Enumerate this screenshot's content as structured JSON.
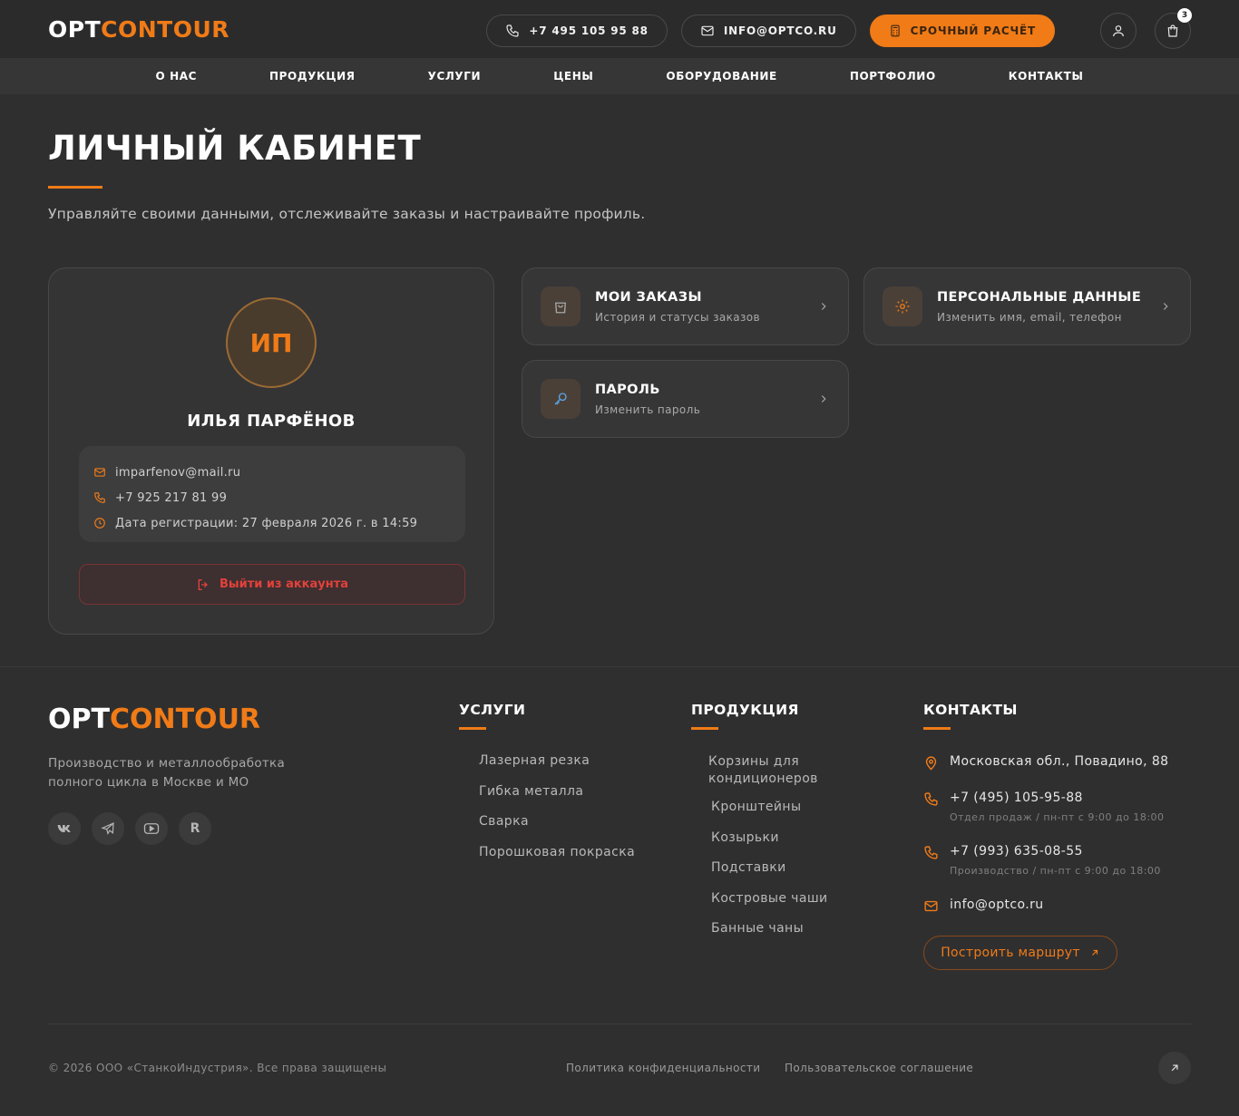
{
  "header": {
    "logo_part1": "OPT",
    "logo_part2": "CONTOUR",
    "phone": "+7 495 105 95 88",
    "email": "INFO@OPTCO.RU",
    "urgent_calc": "СРОЧНЫЙ РАСЧЁТ",
    "cart_count": "3",
    "nav": [
      "О НАС",
      "ПРОДУКЦИЯ",
      "УСЛУГИ",
      "ЦЕНЫ",
      "ОБОРУДОВАНИЕ",
      "ПОРТФОЛИО",
      "КОНТАКТЫ"
    ]
  },
  "page": {
    "title": "ЛИЧНЫЙ КАБИНЕТ",
    "subtitle": "Управляйте своими данными, отслеживайте заказы и настраивайте профиль."
  },
  "profile": {
    "initials": "ИП",
    "name": "ИЛЬЯ ПАРФЁНОВ",
    "email": "imparfenov@mail.ru",
    "phone": "+7 925 217 81 99",
    "registered": "Дата регистрации: 27 февраля 2026 г. в 14:59",
    "logout": "Выйти из аккаунта"
  },
  "actions": [
    {
      "title": "МОИ ЗАКАЗЫ",
      "sub": "История и статусы заказов",
      "icon": "shopping-bag-icon"
    },
    {
      "title": "ПЕРСОНАЛЬНЫЕ ДАННЫЕ",
      "sub": "Изменить имя, email, телефон",
      "icon": "gear-icon"
    },
    {
      "title": "ПАРОЛЬ",
      "sub": "Изменить пароль",
      "icon": "key-icon"
    }
  ],
  "footer": {
    "logo_part1": "OPT",
    "logo_part2": "CONTOUR",
    "desc": "Производство и металлообработка полного цикла в Москве и МО",
    "socials": [
      "vk-icon",
      "telegram-icon",
      "youtube-icon",
      "R"
    ],
    "services_title": "УСЛУГИ",
    "services": [
      "Лазерная резка",
      "Гибка металла",
      "Сварка",
      "Порошковая покраска"
    ],
    "products_title": "ПРОДУКЦИЯ",
    "products": [
      "Корзины для кондиционеров",
      "Кронштейны",
      "Козырьки",
      "Подставки",
      "Костровые чаши",
      "Банные чаны"
    ],
    "contacts_title": "КОНТАКТЫ",
    "address": "Московская обл., Повадино, 88",
    "phone1": "+7 (495) 105-95-88",
    "phone1_note": "Отдел продаж / пн-пт с 9:00 до 18:00",
    "phone2": "+7 (993) 635-08-55",
    "phone2_note": "Производство / пн-пт с 9:00 до 18:00",
    "email": "info@optco.ru",
    "route": "Построить маршрут",
    "copyright": "© 2026 ООО «СтанкоИндустрия». Все права защищены",
    "privacy": "Политика конфиденциальности",
    "terms": "Пользовательское соглашение"
  },
  "colors": {
    "accent": "#f07b17",
    "danger": "#e2413b",
    "background": "#2f2f30"
  }
}
